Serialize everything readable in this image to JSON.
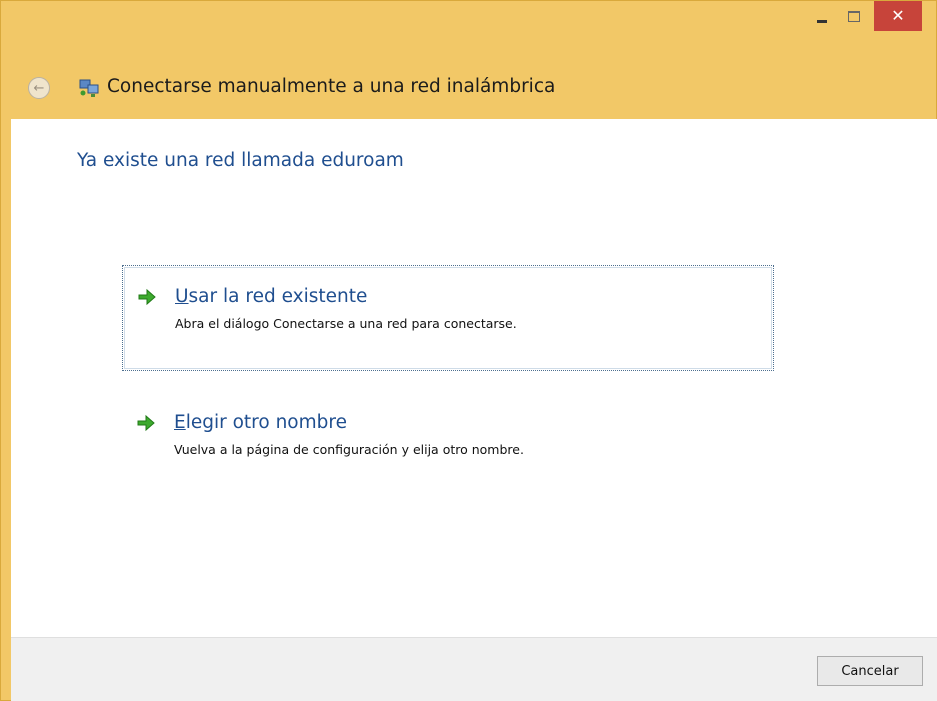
{
  "window": {
    "title": "Conectarse manualmente a una red inalámbrica",
    "controls": {
      "minimize": "−",
      "maximize": "□",
      "close": "✕"
    },
    "accent_color": "#f2c867",
    "close_color": "#c7443a"
  },
  "nav": {
    "back_icon": "back-arrow-icon",
    "title_icon": "network-icon"
  },
  "main": {
    "heading": "Ya existe una red llamada eduroam",
    "options": [
      {
        "title_accel": "U",
        "title_rest": "sar la red existente",
        "description": "Abra el diálogo Conectarse a una red para conectarse.",
        "icon": "green-arrow-icon",
        "focused": true
      },
      {
        "title_accel": "E",
        "title_rest": "legir otro nombre",
        "description": "Vuelva a la página de configuración y elija otro nombre.",
        "icon": "green-arrow-icon",
        "focused": false
      }
    ]
  },
  "footer": {
    "cancel_label": "Cancelar"
  }
}
